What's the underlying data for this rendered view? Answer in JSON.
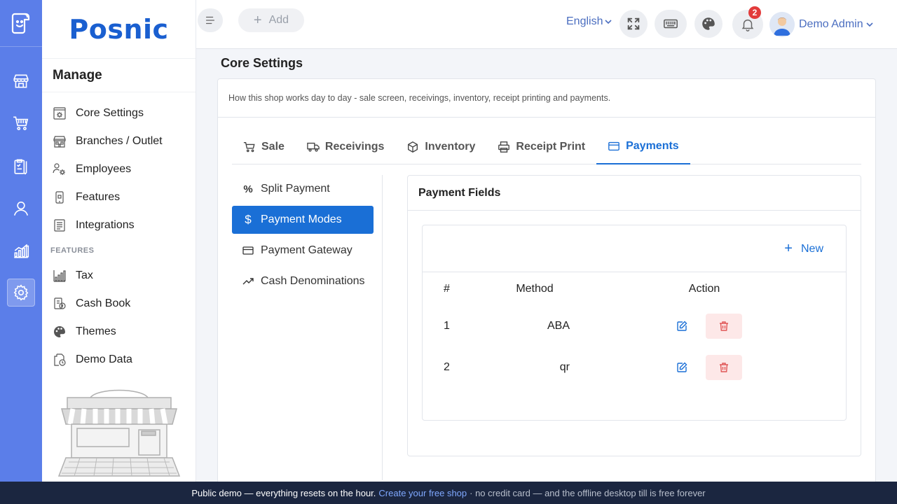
{
  "brand": {
    "name": "Posnic"
  },
  "sidebar": {
    "title": "Manage",
    "items": [
      {
        "label": "Core Settings",
        "icon": "gear-doc-icon"
      },
      {
        "label": "Branches / Outlet",
        "icon": "building-icon"
      },
      {
        "label": "Employees",
        "icon": "people-gear-icon"
      },
      {
        "label": "Features",
        "icon": "mobile-icon"
      },
      {
        "label": "Integrations",
        "icon": "list-doc-icon"
      }
    ],
    "section_label": "FEATURES",
    "features": [
      {
        "label": "Tax",
        "icon": "chart-icon"
      },
      {
        "label": "Cash Book",
        "icon": "book-icon"
      },
      {
        "label": "Themes",
        "icon": "palette-icon"
      },
      {
        "label": "Demo Data",
        "icon": "clock-doc-icon"
      }
    ]
  },
  "topbar": {
    "add_label": "Add",
    "language": "English",
    "notification_count": "2",
    "user_name": "Demo Admin"
  },
  "page": {
    "title": "Core Settings",
    "description": "How this shop works day to day - sale screen, receivings, inventory, receipt printing and payments."
  },
  "tabs": [
    {
      "label": "Sale"
    },
    {
      "label": "Receivings"
    },
    {
      "label": "Inventory"
    },
    {
      "label": "Receipt Print"
    },
    {
      "label": "Payments"
    }
  ],
  "subnav": [
    {
      "label": "Split Payment"
    },
    {
      "label": "Payment Modes"
    },
    {
      "label": "Payment Gateway"
    },
    {
      "label": "Cash Denominations"
    }
  ],
  "payment_fields": {
    "title": "Payment Fields",
    "new_label": "New",
    "columns": {
      "num": "#",
      "method": "Method",
      "action": "Action"
    },
    "rows": [
      {
        "num": "1",
        "method": "ABA"
      },
      {
        "num": "2",
        "method": "qr"
      }
    ]
  },
  "banner": {
    "text_before": "Public demo — everything resets on the hour.",
    "link": "Create your free shop",
    "text_after": "· no credit card — and the offline desktop till is free forever"
  },
  "colors": {
    "rail": "#5b7ee9",
    "brand": "#1a5fd0",
    "accent": "#1a6fd6",
    "banner": "#1b2640",
    "danger": "#e23b3b"
  }
}
